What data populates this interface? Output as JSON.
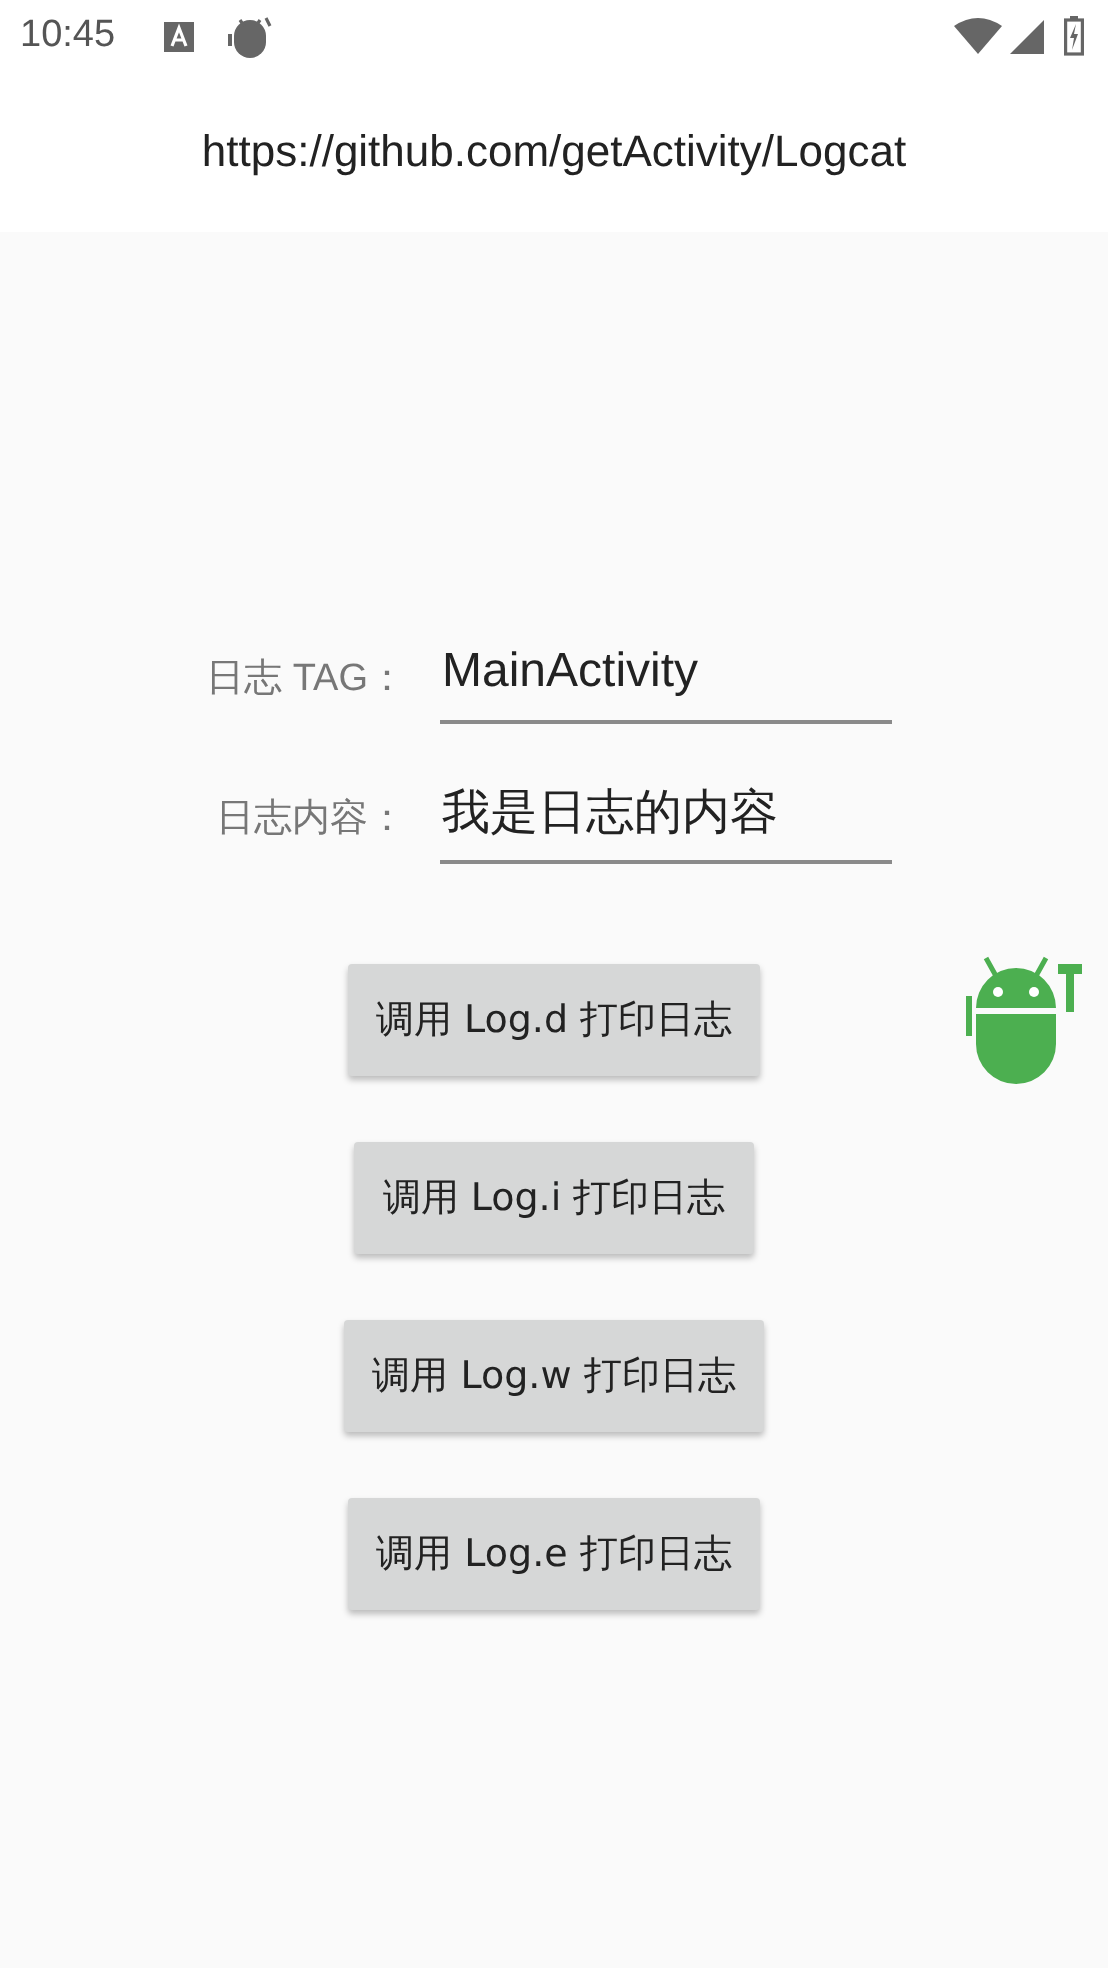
{
  "status_bar": {
    "time": "10:45"
  },
  "header": {
    "url": "https://github.com/getActivity/Logcat"
  },
  "fields": [
    {
      "label": "日志 TAG：",
      "value": "MainActivity"
    },
    {
      "label": "日志内容：",
      "value": "我是日志的内容"
    }
  ],
  "buttons": [
    "调用 Log.d 打印日志",
    "调用 Log.i 打印日志",
    "调用 Log.w 打印日志",
    "调用 Log.e 打印日志"
  ]
}
